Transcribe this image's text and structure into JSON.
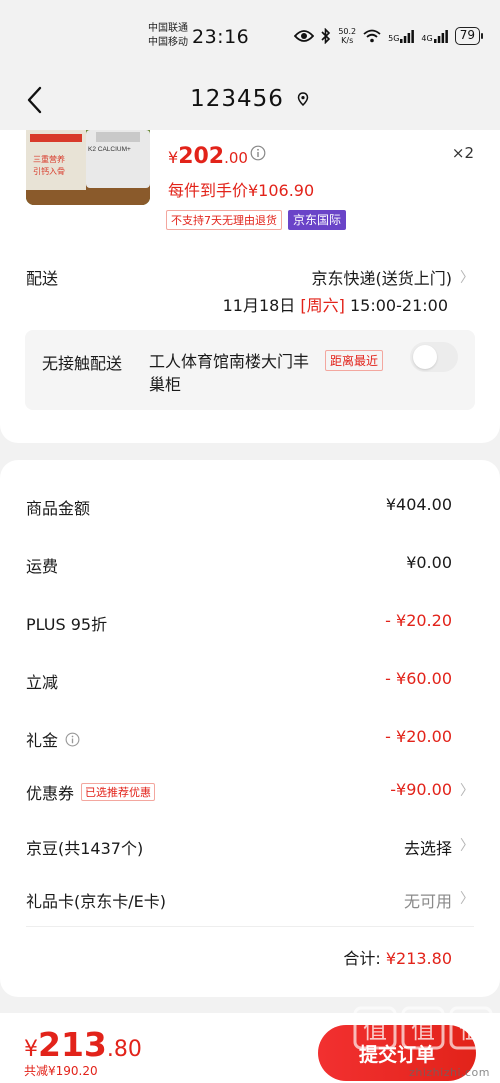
{
  "status_bar": {
    "carrier1": "中国联通",
    "carrier2": "中国移动",
    "time": "23:16",
    "net_speed_value": "50.2",
    "net_speed_unit": "K/s",
    "net_5g": "5G",
    "net_4g": "4G",
    "battery": "79",
    "icons": [
      "eye-icon",
      "bluetooth-icon",
      "wifi-icon",
      "signal-icon",
      "signal-icon"
    ]
  },
  "header": {
    "title": "123456",
    "back_icon": "chevron-left-icon",
    "location_icon": "location-pin-icon"
  },
  "product": {
    "image_text1": "K2 CALCIUM+",
    "image_text2": "三重营养",
    "image_text3": "引钙入骨",
    "price_yen": "¥",
    "price_int": "202",
    "price_dec": ".00",
    "quantity": "×2",
    "per_item_price": "每件到手价¥106.90",
    "badge_no_return": "不支持7天无理由退货",
    "badge_intl": "京东国际"
  },
  "delivery": {
    "label": "配送",
    "method": "京东快递(送货上门)",
    "date": "11月18日",
    "weekday": "[周六]",
    "time_range": "15:00-21:00",
    "contactless_label": "无接触配送",
    "contactless_address": "工人体育馆南楼大门丰巢柜",
    "nearest_badge": "距离最近",
    "contactless_enabled": false
  },
  "summary": {
    "rows": [
      {
        "label": "商品金额",
        "value": "¥404.00"
      },
      {
        "label": "运费",
        "value": "¥0.00"
      },
      {
        "label": "PLUS 95折",
        "value": "- ¥20.20"
      },
      {
        "label": "立减",
        "value": "- ¥60.00"
      },
      {
        "label": "礼金",
        "value": "- ¥20.00"
      },
      {
        "label": "优惠券",
        "tag": "已选推荐优惠",
        "value": "-¥90.00"
      },
      {
        "label": "京豆(共1437个)",
        "value": "去选择"
      },
      {
        "label": "礼品卡(京东卡/E卡)",
        "value": "无可用"
      }
    ],
    "total_label": "合计:",
    "total_value": "¥213.80"
  },
  "bottom_bar": {
    "price_yen": "¥",
    "price_int": "213",
    "price_dec": ".80",
    "saved": "共减¥190.20",
    "submit_label": "提交订单"
  },
  "watermark": {
    "logo_text": "值",
    "site": "zhizhizhi.com"
  },
  "colors": {
    "accent_red": "#e2231a",
    "intl_purple": "#6a44c8",
    "background": "#f2f2f2"
  }
}
